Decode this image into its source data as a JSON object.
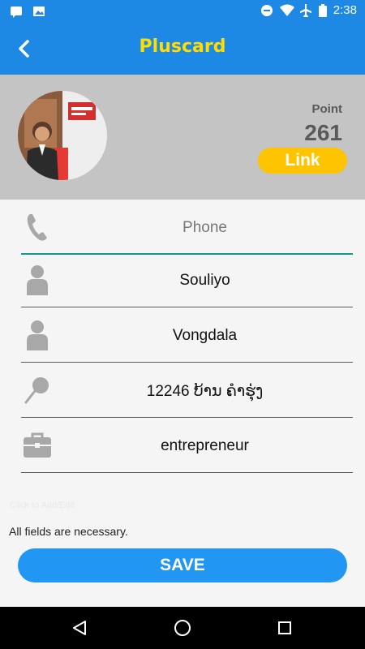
{
  "status_bar": {
    "time": "2:38",
    "left_icons": [
      "message-icon",
      "image-icon"
    ],
    "right_icons": [
      "do-not-disturb-icon",
      "wifi-icon",
      "airplane-icon",
      "battery-icon"
    ]
  },
  "app_bar": {
    "title": "Pluscard",
    "back_icon": "chevron-left-icon",
    "title_color": "#ffdd00",
    "background": "#1e88e5"
  },
  "profile": {
    "point_label": "Point",
    "point_value": "261",
    "link_label": "Link"
  },
  "form": {
    "fields": [
      {
        "icon": "phone-icon",
        "value": "",
        "placeholder": "Phone"
      },
      {
        "icon": "person-icon",
        "value": "Souliyo",
        "placeholder": ""
      },
      {
        "icon": "person-icon",
        "value": "Vongdala",
        "placeholder": ""
      },
      {
        "icon": "location-pin-icon",
        "value": "12246 ບ້ານ ຄໍາຮຸ່ງ",
        "placeholder": ""
      },
      {
        "icon": "briefcase-icon",
        "value": "entrepreneur",
        "placeholder": ""
      }
    ],
    "hint": "Click to Add/Edit",
    "note": "All fields are necessary.",
    "save_label": "SAVE"
  },
  "nav_bar": {
    "buttons": [
      "back-triangle-icon",
      "home-circle-icon",
      "recents-square-icon"
    ]
  }
}
